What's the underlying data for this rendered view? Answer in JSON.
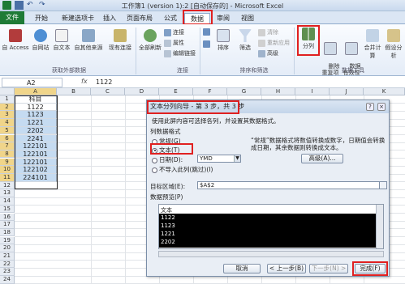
{
  "window": {
    "title": "工作簿1 (version 1):2 [自动保存的] - Microsoft Excel"
  },
  "tabs": [
    "文件",
    "开始",
    "新建选项卡",
    "插入",
    "页面布局",
    "公式",
    "数据",
    "审阅",
    "视图"
  ],
  "ribbon": {
    "get_external": {
      "items": [
        "自 Access",
        "自网站",
        "自文本",
        "自其他来源",
        "现有连接"
      ],
      "group": "获取外部数据"
    },
    "refresh": {
      "label": "全部刷新"
    },
    "connections": {
      "items": [
        "连接",
        "属性",
        "编辑链接"
      ],
      "group": "连接"
    },
    "sort": {
      "label": "排序",
      "filter": "筛选",
      "clear": "清除",
      "reapply": "重新应用",
      "advanced": "高级",
      "group": "排序和筛选"
    },
    "tools": {
      "split": "分列",
      "remove_dup": "删除\n重复项",
      "validation": "数据\n有效性",
      "merge": "合并计算",
      "whatif": "假设分析",
      "group": "数据工具"
    }
  },
  "formula_bar": {
    "name_box": "A2",
    "fx": "fx",
    "value": "1122"
  },
  "sheet": {
    "columns": [
      "A",
      "B",
      "C",
      "D",
      "E",
      "F",
      "G",
      "H",
      "I",
      "J",
      "K"
    ],
    "rows": [
      "1",
      "2",
      "3",
      "4",
      "5",
      "6",
      "7",
      "8",
      "9",
      "10",
      "11",
      "12",
      "13",
      "14",
      "15",
      "16",
      "17",
      "18",
      "19",
      "20",
      "21",
      "22",
      "23",
      "24"
    ],
    "a_values": [
      "科目",
      "1122",
      "1123",
      "1221",
      "2202",
      "2241",
      "122101",
      "122101",
      "122101",
      "122102",
      "224101"
    ]
  },
  "dialog": {
    "title": "文本分列向导 - 第 3 步，共 3 步",
    "help": "?",
    "close": "×",
    "instruction": "使用此屏内容可选择各列，并设置其数据格式。",
    "format_label": "列数据格式",
    "options": [
      "常规(G)",
      "文本(T)",
      "日期(D):",
      "不导入此列(跳过)(I)"
    ],
    "date_format": "YMD",
    "description": "“常规”数据格式将数值转换成数字，日期值会转换成日期，其余数据则转换成文本。",
    "advanced": "高级(A)...",
    "target_label": "目标区域(E):",
    "target_value": "$A$2",
    "preview_label": "数据预览(P)",
    "preview_header": "文本",
    "preview_rows": [
      "1122",
      "1123",
      "1221",
      "2202"
    ],
    "buttons": {
      "cancel": "取消",
      "back": "< 上一步(B)",
      "next": "下一步(N) >",
      "finish": "完成(F)"
    }
  }
}
